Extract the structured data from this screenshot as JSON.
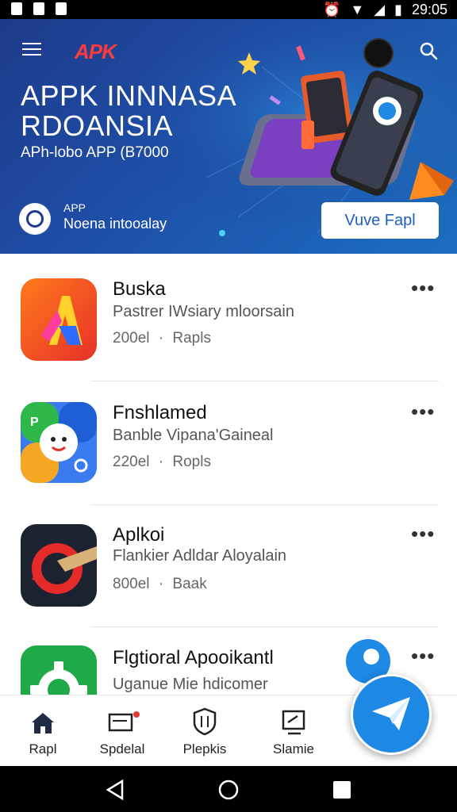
{
  "status_bar": {
    "time": "29:05"
  },
  "header": {
    "brand": "APK",
    "title_line1": "APPK INNNASA",
    "title_line2": "RDOANSIA",
    "subtitle": "APh-lobo APP (B7000",
    "badge_label": "APP",
    "badge_sub": "Noena intooalay",
    "cta_label": "Vuve Fapl"
  },
  "apps": [
    {
      "name": "Buska",
      "subtitle": "Pastrer IWsiary mloorsain",
      "meta_count": "200el",
      "meta_sep": "·",
      "meta_label": "Rapls",
      "icon": "buska-app-icon"
    },
    {
      "name": "Fnshlamed",
      "subtitle": "Banble Vipana'Gaineal",
      "meta_count": "220el",
      "meta_sep": "·",
      "meta_label": "Ropls",
      "icon": "fnshlamed-app-icon"
    },
    {
      "name": "Aplkoi",
      "subtitle": "Flankier Adldar Aloyalain",
      "meta_count": "800el",
      "meta_sep": "·",
      "meta_label": "Baak",
      "icon": "aplkoi-app-icon"
    },
    {
      "name": "Flgtioral Apooikantl",
      "subtitle": "Uganue Mie hdicomer",
      "meta_count": "",
      "meta_sep": "",
      "meta_label": "",
      "icon": "flgtioral-app-icon"
    }
  ],
  "more_label": "•••",
  "bottom_nav": [
    {
      "label": "Rapl",
      "icon": "home-icon"
    },
    {
      "label": "Spdelal",
      "icon": "special-icon"
    },
    {
      "label": "Plepkis",
      "icon": "shield-icon"
    },
    {
      "label": "Slamie",
      "icon": "edit-icon"
    }
  ],
  "colors": {
    "hero_bg": "#1e3a8a",
    "accent": "#1e88e5",
    "cta_text": "#1f5fbf"
  }
}
